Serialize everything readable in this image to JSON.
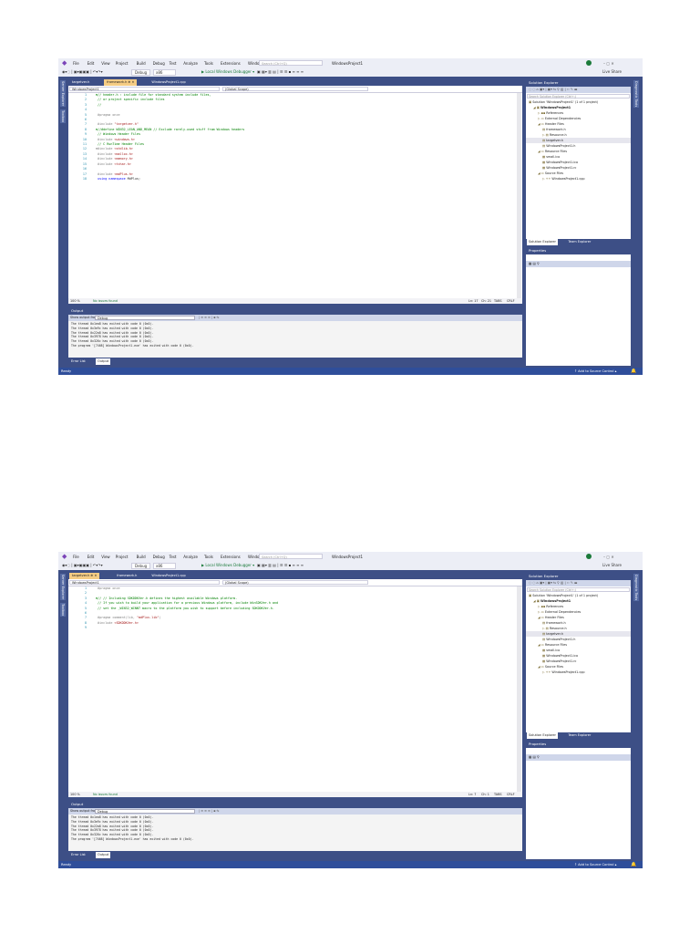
{
  "windows": [
    {
      "menu": [
        "File",
        "Edit",
        "View",
        "Project",
        "Build",
        "Debug",
        "Test",
        "Analyze",
        "Tools",
        "Extensions",
        "Window",
        "Help"
      ],
      "search_placeholder": "Search (Ctrl+Q)",
      "solution_name": "WindowsProject1",
      "avatar_initials": "RV",
      "live_share": "Live Share",
      "toolbar": {
        "config": "Debug",
        "platform": "x86",
        "debugger": "▶ Local Windows Debugger ▾"
      },
      "side_tabs": [
        "Server Explorer",
        "Toolbox"
      ],
      "right_tab": "Diagnostic Tools",
      "doc_tabs": [
        {
          "label": "targetver.h",
          "active": false
        },
        {
          "label": "framework.h  ⊕ ✕",
          "active": true
        },
        {
          "label": "WindowsProject1.cpp",
          "active": false
        }
      ],
      "nav": {
        "project": "WindowsProject1",
        "scope": "(Global Scope)"
      },
      "code": [
        [
          [
            "comment",
            "⊟// header.h : include file for standard system include files,"
          ]
        ],
        [
          [
            "comment",
            " // or project specific include files"
          ]
        ],
        [
          [
            "comment",
            " //"
          ]
        ],
        [],
        [
          [
            "pre",
            "  #pragma once"
          ]
        ],
        [],
        [
          [
            "pre",
            "  #include "
          ],
          [
            "str",
            "\"targetver.h\""
          ]
        ],
        [
          [
            "comment",
            "⊟//#define WIN32_LEAN_AND_MEAN             // Exclude rarely-used stuff from Windows headers"
          ]
        ],
        [
          [
            "comment",
            "  // Windows Header Files"
          ]
        ],
        [
          [
            "pre",
            "  #include "
          ],
          [
            "str",
            "<windows.h>"
          ]
        ],
        [
          [
            "comment",
            "  // C RunTime Header Files"
          ]
        ],
        [
          [
            "pre",
            "⊟#include "
          ],
          [
            "str",
            "<stdlib.h>"
          ]
        ],
        [
          [
            "pre",
            "  #include "
          ],
          [
            "str",
            "<malloc.h>"
          ]
        ],
        [
          [
            "pre",
            "  #include "
          ],
          [
            "str",
            "<memory.h>"
          ]
        ],
        [
          [
            "pre",
            "  #include "
          ],
          [
            "str",
            "<tchar.h>"
          ]
        ],
        [],
        [
          [
            "pre",
            "  #include "
          ],
          [
            "str",
            "<mdPlus.h>"
          ]
        ],
        [
          [
            "kw",
            "  using namespace "
          ],
          [
            "plain",
            "MdPlus;"
          ]
        ]
      ],
      "zoom": "100 %",
      "issues": "No issues found",
      "cursor": {
        "ln": "Ln: 17",
        "ch": "Ch: 21",
        "tabs": "TABS",
        "eol": "CRLF"
      },
      "output": {
        "title": "Output",
        "show_from_label": "Show output from:",
        "source": "Debug",
        "lines": [
          "The thread 0x1ea8 has exited with code 0 (0x0).",
          "The thread 0x3e9c has exited with code 0 (0x0).",
          "The thread 0x22a8 has exited with code 0 (0x0).",
          "The thread 0x3978 has exited with code 0 (0x0).",
          "The thread 0x326c has exited with code 0 (0x0).",
          "The program '[7468] WindowsProject1.exe' has exited with code 0 (0x0)."
        ]
      },
      "bottom_tabs": [
        {
          "label": "Error List",
          "active": false
        },
        {
          "label": "Output",
          "active": true
        }
      ],
      "solution_explorer": {
        "title": "Solution Explorer",
        "search_placeholder": "Search Solution Explorer (Ctrl+;)",
        "tree": [
          {
            "label": "Solution 'WindowsProject1' (1 of 1 project)",
            "level": 0,
            "icon": "▣"
          },
          {
            "label": "WindowsProject1",
            "level": 1,
            "icon": "◢ ▣",
            "bold": true
          },
          {
            "label": "References",
            "level": 2,
            "icon": "▷ ▪▪"
          },
          {
            "label": "External Dependencies",
            "level": 2,
            "icon": "▷ ▭"
          },
          {
            "label": "Header Files",
            "level": 2,
            "icon": "◢ ▭"
          },
          {
            "label": "framework.h",
            "level": 3,
            "icon": "▤"
          },
          {
            "label": "Resource.h",
            "level": 3,
            "icon": "▷ ▤"
          },
          {
            "label": "targetver.h",
            "level": 3,
            "icon": "▤",
            "selected": true
          },
          {
            "label": "WindowsProject1.h",
            "level": 3,
            "icon": "▤"
          },
          {
            "label": "Resource Files",
            "level": 2,
            "icon": "◢ ▭"
          },
          {
            "label": "small.ico",
            "level": 3,
            "icon": "▦"
          },
          {
            "label": "WindowsProject1.ico",
            "level": 3,
            "icon": "▦"
          },
          {
            "label": "WindowsProject1.rc",
            "level": 3,
            "icon": "▦"
          },
          {
            "label": "Source Files",
            "level": 2,
            "icon": "◢ ▭"
          },
          {
            "label": "WindowsProject1.cpp",
            "level": 3,
            "icon": "▷ ++"
          }
        ]
      },
      "panel_tabs": [
        {
          "label": "Solution Explorer",
          "active": true
        },
        {
          "label": "Team Explorer",
          "active": false
        }
      ],
      "properties_title": "Properties",
      "status": {
        "ready": "Ready",
        "source_control": "↑ Add to Source Control ▴"
      }
    },
    {
      "menu": [
        "File",
        "Edit",
        "View",
        "Project",
        "Build",
        "Debug",
        "Test",
        "Analyze",
        "Tools",
        "Extensions",
        "Window",
        "Help"
      ],
      "search_placeholder": "Search (Ctrl+Q)",
      "solution_name": "WindowsProject1",
      "avatar_initials": "RV",
      "live_share": "Live Share",
      "toolbar": {
        "config": "Debug",
        "platform": "x86",
        "debugger": "▶ Local Windows Debugger ▾"
      },
      "side_tabs": [
        "Server Explorer",
        "Toolbox"
      ],
      "right_tab": "Diagnostic Tools",
      "doc_tabs": [
        {
          "label": "targetver.h  ⊕ ✕",
          "active": true
        },
        {
          "label": "framework.h",
          "active": false
        },
        {
          "label": "WindowsProject1.cpp",
          "active": false
        }
      ],
      "nav": {
        "project": "WindowsProject1",
        "scope": "(Global Scope)"
      },
      "code": [
        [
          [
            "pre",
            "  #pragma once"
          ]
        ],
        [],
        [
          [
            "comment",
            "⊟// // Including SDKDDKVer.h defines the highest available Windows platform."
          ]
        ],
        [
          [
            "comment",
            "  // If you wish to build your application for a previous Windows platform, include WinSDKVer.h and"
          ]
        ],
        [
          [
            "comment",
            "  // set the _WIN32_WINNT macro to the platform you wish to support before including SDKDDKVer.h."
          ]
        ],
        [],
        [
          [
            "pre",
            "  #pragma comment(lib, "
          ],
          [
            "str",
            "\"mdPlus.lib\""
          ],
          [
            "pre",
            ")"
          ]
        ],
        [
          [
            "pre",
            "  #include "
          ],
          [
            "str",
            "<SDKDDKVer.h>"
          ]
        ],
        []
      ],
      "zoom": "100 %",
      "issues": "No issues found",
      "cursor": {
        "ln": "Ln: 7",
        "ch": "Ch: 1",
        "tabs": "TABS",
        "eol": "CRLF"
      },
      "output": {
        "title": "Output",
        "show_from_label": "Show output from:",
        "source": "Debug",
        "lines": [
          "The thread 0x1ea8 has exited with code 0 (0x0).",
          "The thread 0x3e9c has exited with code 0 (0x0).",
          "The thread 0x22a8 has exited with code 0 (0x0).",
          "The thread 0x3978 has exited with code 0 (0x0).",
          "The thread 0x326c has exited with code 0 (0x0).",
          "The program '[7468] WindowsProject1.exe' has exited with code 0 (0x0)."
        ]
      },
      "bottom_tabs": [
        {
          "label": "Error List",
          "active": false
        },
        {
          "label": "Output",
          "active": true
        }
      ],
      "solution_explorer": {
        "title": "Solution Explorer",
        "search_placeholder": "Search Solution Explorer (Ctrl+;)",
        "tree": [
          {
            "label": "Solution 'WindowsProject1' (1 of 1 project)",
            "level": 0,
            "icon": "▣"
          },
          {
            "label": "WindowsProject1",
            "level": 1,
            "icon": "◢ ▣",
            "bold": true
          },
          {
            "label": "References",
            "level": 2,
            "icon": "▷ ▪▪"
          },
          {
            "label": "External Dependencies",
            "level": 2,
            "icon": "▷ ▭"
          },
          {
            "label": "Header Files",
            "level": 2,
            "icon": "◢ ▭"
          },
          {
            "label": "framework.h",
            "level": 3,
            "icon": "▤"
          },
          {
            "label": "Resource.h",
            "level": 3,
            "icon": "▷ ▤"
          },
          {
            "label": "targetver.h",
            "level": 3,
            "icon": "▤",
            "selected": true
          },
          {
            "label": "WindowsProject1.h",
            "level": 3,
            "icon": "▤"
          },
          {
            "label": "Resource Files",
            "level": 2,
            "icon": "◢ ▭"
          },
          {
            "label": "small.ico",
            "level": 3,
            "icon": "▦"
          },
          {
            "label": "WindowsProject1.ico",
            "level": 3,
            "icon": "▦"
          },
          {
            "label": "WindowsProject1.rc",
            "level": 3,
            "icon": "▦"
          },
          {
            "label": "Source Files",
            "level": 2,
            "icon": "◢ ▭"
          },
          {
            "label": "WindowsProject1.cpp",
            "level": 3,
            "icon": "▷ ++"
          }
        ]
      },
      "panel_tabs": [
        {
          "label": "Solution Explorer",
          "active": true
        },
        {
          "label": "Team Explorer",
          "active": false
        }
      ],
      "properties_title": "Properties",
      "status": {
        "ready": "Ready",
        "source_control": "↑ Add to Source Control ▴"
      }
    }
  ]
}
